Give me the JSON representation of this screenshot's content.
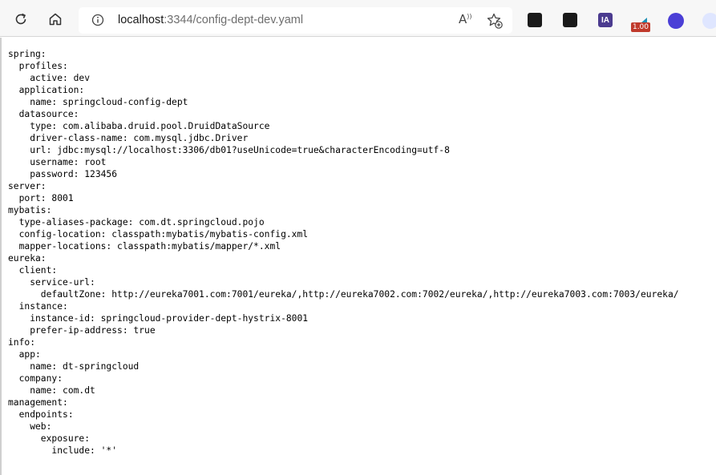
{
  "address_bar": {
    "host": "localhost",
    "path": ":3344/config-dept-dev.yaml"
  },
  "toolbar": {
    "read_aloud_glyph": "A",
    "ext3_label": "IA",
    "ext4_badge": "1.00"
  },
  "document": {
    "text": "spring:\n  profiles:\n    active: dev\n  application:\n    name: springcloud-config-dept\n  datasource:\n    type: com.alibaba.druid.pool.DruidDataSource\n    driver-class-name: com.mysql.jdbc.Driver\n    url: jdbc:mysql://localhost:3306/db01?useUnicode=true&characterEncoding=utf-8\n    username: root\n    password: 123456\nserver:\n  port: 8001\nmybatis:\n  type-aliases-package: com.dt.springcloud.pojo\n  config-location: classpath:mybatis/mybatis-config.xml\n  mapper-locations: classpath:mybatis/mapper/*.xml\neureka:\n  client:\n    service-url:\n      defaultZone: http://eureka7001.com:7001/eureka/,http://eureka7002.com:7002/eureka/,http://eureka7003.com:7003/eureka/\n  instance:\n    instance-id: springcloud-provider-dept-hystrix-8001\n    prefer-ip-address: true\ninfo:\n  app:\n    name: dt-springcloud\n  company:\n    name: com.dt\nmanagement:\n  endpoints:\n    web:\n      exposure:\n        include: '*'"
  }
}
